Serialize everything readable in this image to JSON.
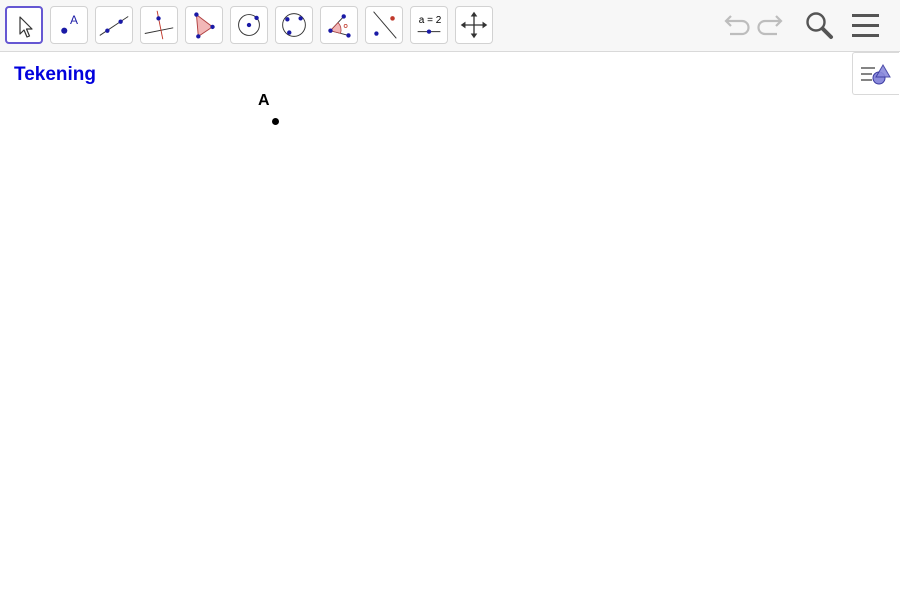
{
  "toolbar": {
    "tools": [
      {
        "name": "move",
        "selected": true
      },
      {
        "name": "point",
        "label": "A"
      },
      {
        "name": "line"
      },
      {
        "name": "perpendicular-line"
      },
      {
        "name": "polygon"
      },
      {
        "name": "circle-center-point"
      },
      {
        "name": "circle-three-points"
      },
      {
        "name": "angle"
      },
      {
        "name": "reflect-about-line"
      },
      {
        "name": "slider",
        "label": "a = 2"
      },
      {
        "name": "move-graphics-view"
      }
    ],
    "right_icons": [
      "undo-icon",
      "redo-icon",
      "search-icon",
      "menu-icon"
    ]
  },
  "view": {
    "title": "Tekening"
  },
  "canvas": {
    "points": [
      {
        "label": "A"
      }
    ]
  },
  "colors": {
    "accent": "#6557d2",
    "title": "#0000dd",
    "point_blue": "#1a1aa6",
    "polygon_fill": "#f2b7b7",
    "angle_red": "#c0392b"
  }
}
